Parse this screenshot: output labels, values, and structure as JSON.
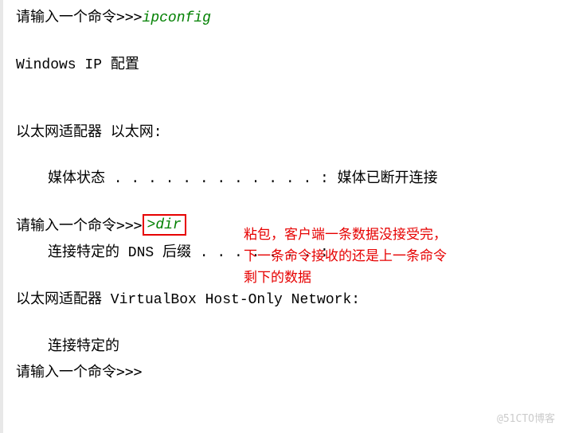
{
  "terminal": {
    "prompt_label": "请输入一个命令",
    "prompt_marker": ">>>",
    "cmd1": "ipconfig",
    "output_header": "Windows IP 配置",
    "adapter1_title": "以太网适配器 以太网:",
    "adapter1_media": "媒体状态  . . . . . . . . . . . . : 媒体已断开连接",
    "cmd2_marker_partial": ">",
    "cmd2": "dir",
    "adapter1_dns": "连接特定的 DNS 后缀 . . . . . . . :",
    "adapter2_title": "以太网适配器 VirtualBox Host-Only Network:",
    "adapter2_dns": "连接特定的",
    "prompt_empty": ">>>"
  },
  "annotation": {
    "line1": "粘包，客户端一条数据没接受完，",
    "line2": "下一条命令接收的还是上一条命令",
    "line3": "剩下的数据"
  },
  "watermark": "@51CTO博客"
}
